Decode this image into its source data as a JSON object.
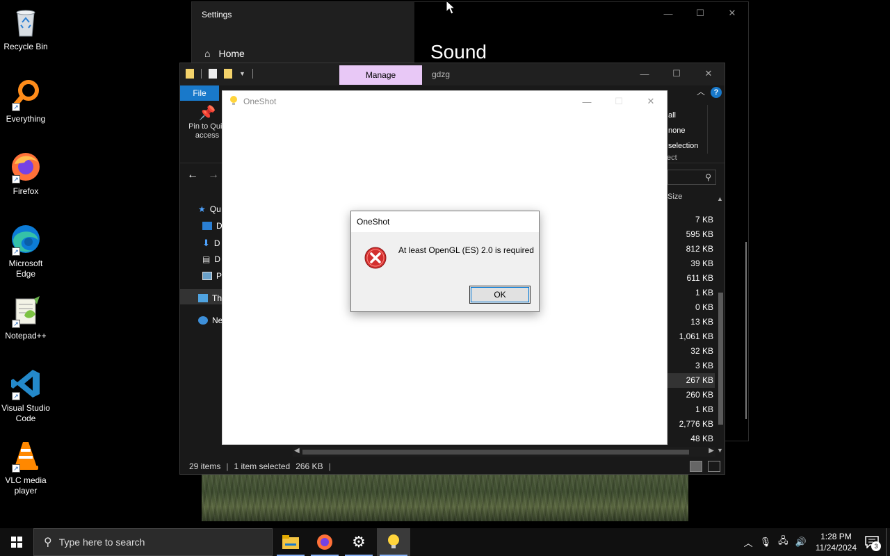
{
  "desktop": {
    "icons": [
      {
        "label": "Recycle Bin",
        "icon": "recycle-bin-icon"
      },
      {
        "label": "Everything",
        "icon": "everything-search-icon"
      },
      {
        "label": "Firefox",
        "icon": "firefox-icon"
      },
      {
        "label": "Microsoft Edge",
        "icon": "edge-icon"
      },
      {
        "label": "Notepad++",
        "icon": "notepadpp-icon"
      },
      {
        "label": "Visual Studio Code",
        "icon": "vscode-icon"
      },
      {
        "label": "VLC media player",
        "icon": "vlc-icon"
      }
    ]
  },
  "settings": {
    "title": "Settings",
    "home_label": "Home",
    "heading": "Sound"
  },
  "explorer": {
    "manage_tab": "Manage",
    "window_title": "gdzg",
    "file_tab": "File",
    "pin_label_1": "Pin to Quic",
    "pin_label_2": "access",
    "select_items": [
      "all",
      "none",
      "selection"
    ],
    "select_group": "ect",
    "nav_items": [
      {
        "label": "Qu",
        "icon": "star-icon"
      },
      {
        "label": "D",
        "icon": "desktop-icon"
      },
      {
        "label": "D",
        "icon": "download-icon"
      },
      {
        "label": "D",
        "icon": "document-icon"
      },
      {
        "label": "Pi",
        "icon": "pictures-icon"
      },
      {
        "label": "Thi",
        "icon": "this-pc-icon"
      },
      {
        "label": "Ne",
        "icon": "network-icon"
      }
    ],
    "size_header": "Size",
    "sizes": [
      "7 KB",
      "595 KB",
      "812 KB",
      "39 KB",
      "611 KB",
      "1 KB",
      "0 KB",
      "13 KB",
      "1,061 KB",
      "32 KB",
      "3 KB",
      "267 KB",
      "260 KB",
      "1 KB",
      "2,776 KB",
      "48 KB"
    ],
    "selected_index": 11,
    "status_items": "29 items",
    "status_selected": "1 item selected",
    "status_size": "266 KB"
  },
  "oneshot": {
    "window_title": "OneShot"
  },
  "dialog": {
    "title": "OneShot",
    "message": "At least OpenGL (ES) 2.0 is required",
    "ok_label": "OK"
  },
  "taskbar": {
    "search_placeholder": "Type here to search",
    "time": "1:28 PM",
    "date": "11/24/2024",
    "notification_count": "3"
  },
  "colors": {
    "manage_tab": "#e8c8f6",
    "file_tab": "#1979ca",
    "error_red": "#d32f2f"
  }
}
